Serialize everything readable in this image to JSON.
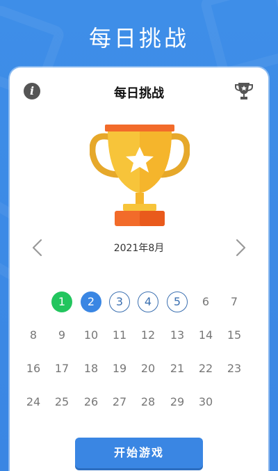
{
  "header": {
    "title": "每日挑战"
  },
  "card": {
    "title": "每日挑战",
    "month": "2021年8月",
    "start_button": "开始游戏"
  },
  "calendar": {
    "weeks": [
      [
        null,
        {
          "d": "1",
          "s": "done"
        },
        {
          "d": "2",
          "s": "today"
        },
        {
          "d": "3",
          "s": "pending"
        },
        {
          "d": "4",
          "s": "pending"
        },
        {
          "d": "5",
          "s": "pending"
        },
        {
          "d": "6",
          "s": "normal"
        },
        {
          "d": "7",
          "s": "normal"
        }
      ],
      [
        {
          "d": "8",
          "s": "normal"
        },
        {
          "d": "9",
          "s": "normal"
        },
        {
          "d": "10",
          "s": "normal"
        },
        {
          "d": "11",
          "s": "normal"
        },
        {
          "d": "12",
          "s": "normal"
        },
        {
          "d": "13",
          "s": "normal"
        },
        {
          "d": "14",
          "s": "normal"
        },
        {
          "d": "15",
          "s": "normal"
        }
      ],
      [
        {
          "d": "16",
          "s": "normal"
        },
        {
          "d": "17",
          "s": "normal"
        },
        {
          "d": "18",
          "s": "normal"
        },
        {
          "d": "19",
          "s": "normal"
        },
        {
          "d": "20",
          "s": "normal"
        },
        {
          "d": "21",
          "s": "normal"
        },
        {
          "d": "22",
          "s": "normal"
        },
        {
          "d": "23",
          "s": "normal"
        }
      ],
      [
        {
          "d": "24",
          "s": "normal"
        },
        {
          "d": "25",
          "s": "normal"
        },
        {
          "d": "26",
          "s": "normal"
        },
        {
          "d": "27",
          "s": "normal"
        },
        {
          "d": "28",
          "s": "normal"
        },
        {
          "d": "29",
          "s": "normal"
        },
        {
          "d": "30",
          "s": "normal"
        },
        null
      ]
    ]
  },
  "icons": {
    "info": "info-icon",
    "trophy_small": "trophy-icon",
    "trophy_large": "trophy-icon",
    "prev": "chevron-left-icon",
    "next": "chevron-right-icon"
  },
  "colors": {
    "background": "#3e8ee8",
    "accent": "#3a86e3",
    "done": "#22c55e",
    "trophy_gold": "#f7c43a",
    "trophy_base": "#f26b2a"
  }
}
